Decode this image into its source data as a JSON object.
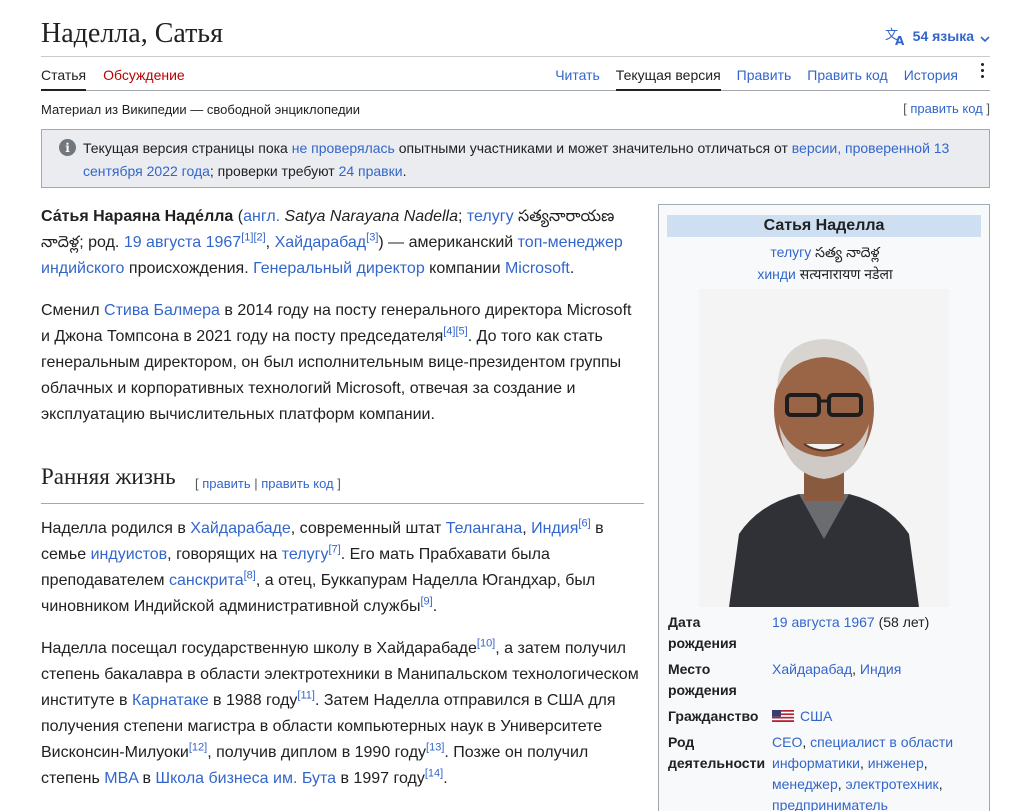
{
  "header": {
    "title": "Наделла, Сатья",
    "languages_label": "54 языка"
  },
  "tabs": {
    "article": "Статья",
    "talk": "Обсуждение",
    "read": "Читать",
    "current": "Текущая версия",
    "edit": "Править",
    "edit_source": "Править код",
    "history": "История"
  },
  "tagline": "Материал из Википедии — свободной энциклопедии",
  "edit_source_top": "править код",
  "notice": {
    "t1": "Текущая версия страницы пока ",
    "l1": "не проверялась",
    "t2": " опытными участниками и может значительно отличаться от ",
    "l2": "версии, проверенной 13 сентября 2022 года",
    "t3": "; проверки требуют ",
    "l3": "24 правки",
    "t4": "."
  },
  "intro": {
    "name_bold": "Са́тья Нараяна Наде́лла",
    "t1": " (",
    "l_eng": "англ.",
    "eng_name": " Satya Narayana Nadella",
    "t2": "; ",
    "l_telugu": "телугу",
    "telugu_name": " సత్యనారాయణ నాదెళ్ల",
    "t3": "; род. ",
    "l_date": "19 августа 1967",
    "ref1": "[1]",
    "ref2": "[2]",
    "t4": ", ",
    "l_city": "Хайдарабад",
    "ref3": "[3]",
    "t5": ") — американский ",
    "l_topmanager": "топ-менеджер",
    "t6": " ",
    "l_indian": "индийского",
    "t7": " происхождения. ",
    "l_ceo": "Генеральный директор",
    "t8": " компании ",
    "l_ms": "Microsoft",
    "t9": "."
  },
  "para2": {
    "t1": "Сменил ",
    "l_ballmer": "Стива Балмера",
    "t2": " в 2014 году на посту генерального директора Microsoft и Джона Томпсона в 2021 году на посту председателя",
    "ref4": "[4]",
    "ref5": "[5]",
    "t3": ". До того как стать генеральным директором, он был исполнительным вице-президентом группы облачных и корпоративных технологий Microsoft, отвечая за создание и эксплуатацию вычислительных платформ компании."
  },
  "section1": {
    "heading": "Ранняя жизнь",
    "edit_l": "[ ",
    "edit": "править",
    "sep": " | ",
    "edit_src": "править код",
    "edit_r": " ]"
  },
  "para3": {
    "t1": "Наделла родился в ",
    "l_hyd": "Хайдарабаде",
    "t2": ", современный штат ",
    "l_tel": "Телангана",
    "t3": ", ",
    "l_ind": "Индия",
    "ref6": "[6]",
    "t4": " в семье ",
    "l_hindu": "индуистов",
    "t5": ", говорящих на ",
    "l_telugu": "телугу",
    "ref7": "[7]",
    "t6": ". Его мать Прабхавати была преподавателем ",
    "l_sanskrit": "санскрита",
    "ref8": "[8]",
    "t7": ", а отец, Буккапурам Наделла Югандхар, был чиновником Индийской административной службы",
    "ref9": "[9]",
    "t8": "."
  },
  "para4": {
    "t1": "Наделла посещал государственную школу в Хайдарабаде",
    "ref10": "[10]",
    "t2": ", а затем получил степень бакалавра в области электротехники в Манипальском технологическом институте в ",
    "l_karnataka": "Карнатаке",
    "t3": " в 1988 году",
    "ref11": "[11]",
    "t4": ". Затем Наделла отправился в США для получения степени магистра в области компьютерных наук в Университете Висконсин-Милуоки",
    "ref12": "[12]",
    "t5": ", получив диплом в 1990 году",
    "ref13": "[13]",
    "t6": ". Позже он получил степень ",
    "l_mba": "MBA",
    "t7": " в ",
    "l_booth": "Школа бизнеса им. Бута",
    "t8": " в 1997 году",
    "ref14": "[14]",
    "t9": "."
  },
  "infobox": {
    "title": "Сатья Наделла",
    "telugu_label": "телугу",
    "telugu_value": " సత్య నాదెళ్ల",
    "hindi_label": "хинди",
    "hindi_value": " सत्यनारायण नडेला",
    "rows": {
      "birth_date_label": "Дата рождения",
      "birth_date_link": "19 августа 1967",
      "birth_date_age": " (58 лет)",
      "birth_place_label": "Место рождения",
      "birth_place_city": "Хайдарабад",
      "birth_place_sep": ", ",
      "birth_place_country": "Индия",
      "citizenship_label": "Гражданство",
      "citizenship_value": "США",
      "occupation_label": "Род деятельности",
      "occ_1": "CEO",
      "occ_sep1": ", ",
      "occ_2": "специалист в области информатики",
      "occ_sep2": ", ",
      "occ_3": "инженер",
      "occ_sep3": ", ",
      "occ_4": "менеджер",
      "occ_sep4": ", ",
      "occ_5": "электротехник",
      "occ_sep5": ", ",
      "occ_6": "предприниматель"
    }
  },
  "icons": {
    "language": "translate-icon",
    "info": "info-icon",
    "more": "more-vertical-icon",
    "flag": "us-flag-icon"
  },
  "colors": {
    "link": "#3366cc",
    "talk_link": "#ba0000",
    "infobox_title_bg": "#cedff2",
    "notice_bg": "#eaecf0"
  }
}
